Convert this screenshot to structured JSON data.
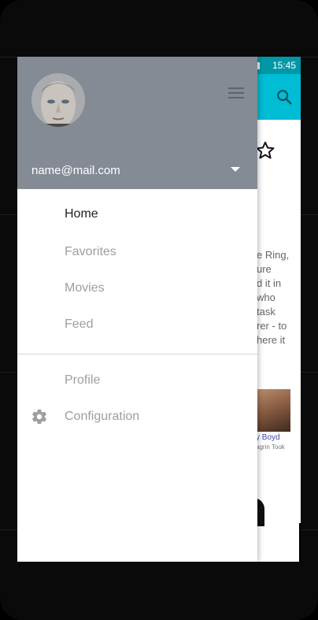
{
  "status_bar": {
    "time": "15:45"
  },
  "background_content": {
    "text_lines": [
      "e Ring,",
      "ure",
      "d it in",
      "who",
      "task",
      "rer - to",
      "here it"
    ],
    "actor_name": "y Boyd",
    "actor_role": "agrin Took"
  },
  "drawer": {
    "account_email": "name@mail.com",
    "nav_items": [
      {
        "label": "Home",
        "active": true
      },
      {
        "label": "Favorites",
        "active": false
      },
      {
        "label": "Movies",
        "active": false
      },
      {
        "label": "Feed",
        "active": false
      }
    ],
    "secondary_items": [
      {
        "label": "Profile",
        "icon": "none"
      },
      {
        "label": "Configuration",
        "icon": "gear-icon"
      }
    ]
  },
  "colors": {
    "header_bg": "#858b95",
    "appbar": "#00bcd4",
    "statusbar": "#0097a7",
    "active_text": "#212121",
    "inactive_text": "#9e9e9e"
  }
}
